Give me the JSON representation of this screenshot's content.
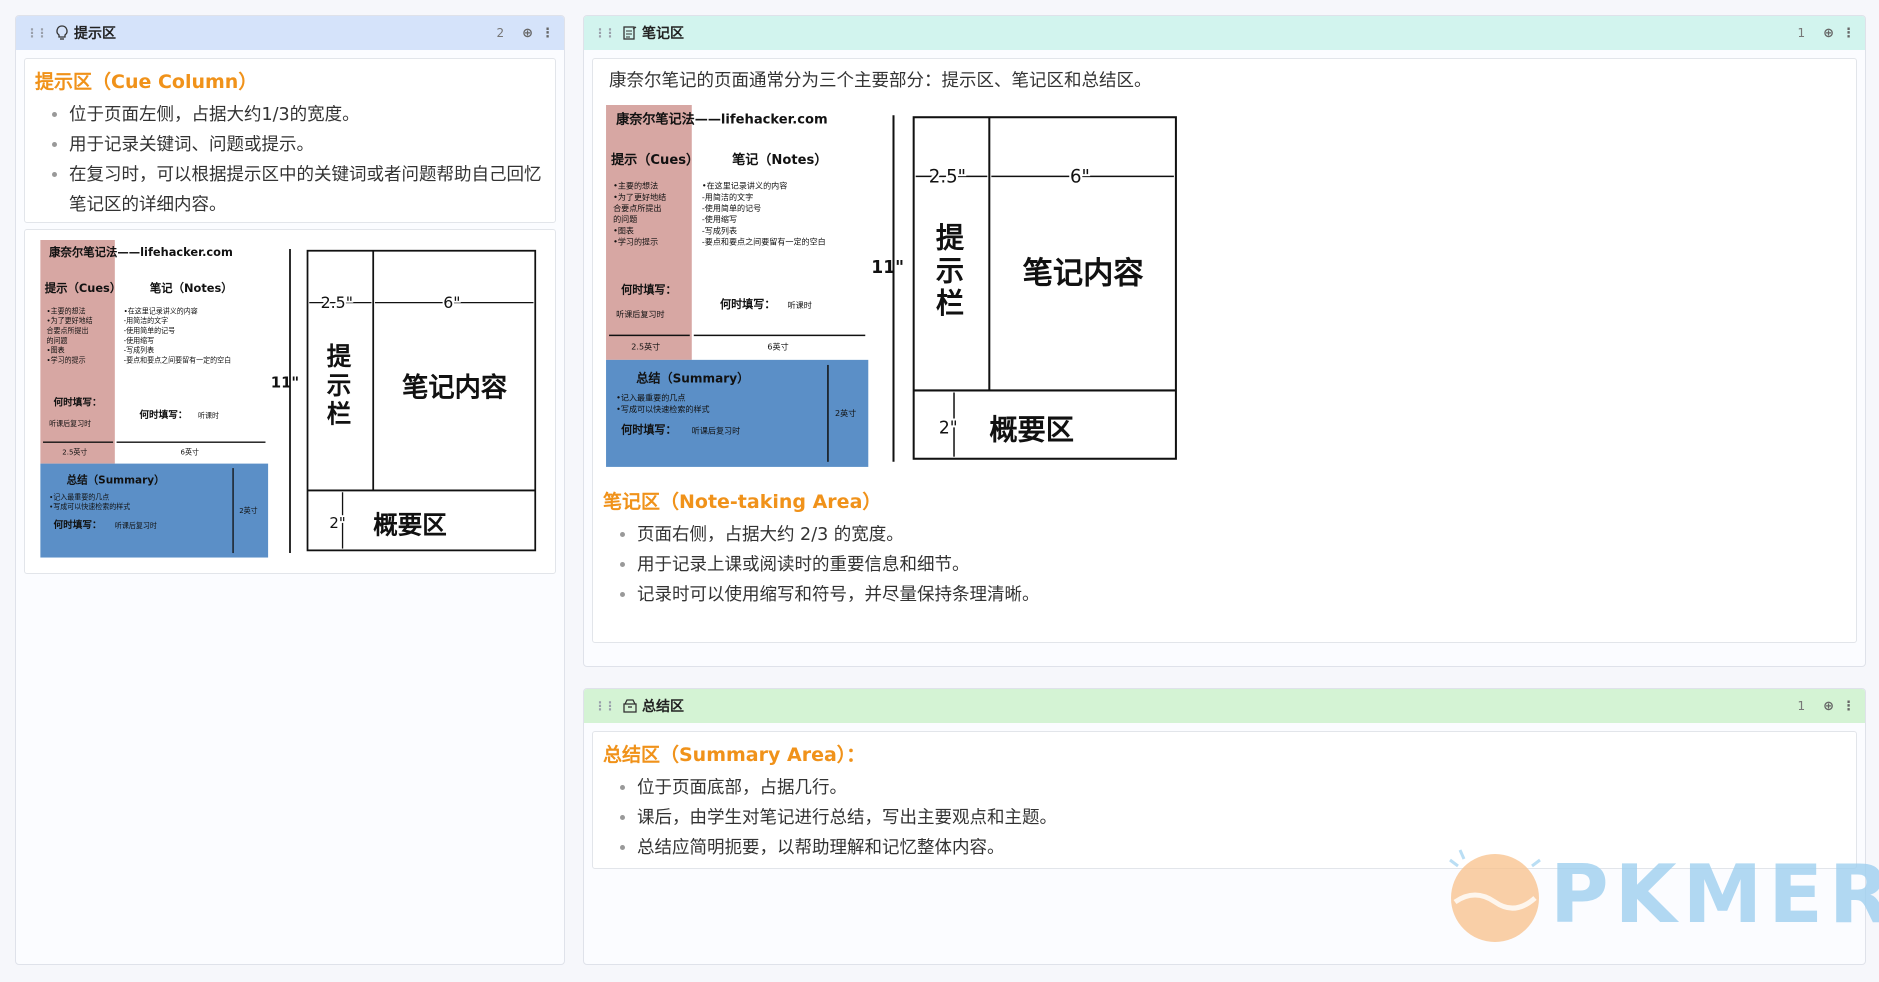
{
  "columns": [
    {
      "title": "提示区",
      "count": "2",
      "icon": "lightbulb-icon",
      "color": "#d5e3fa"
    },
    {
      "title": "笔记区",
      "count": "1",
      "icon": "note-icon",
      "color": "#d2f4ee"
    },
    {
      "title": "总结区",
      "count": "1",
      "icon": "archive-icon",
      "color": "#d4f3d4"
    }
  ],
  "cue": {
    "title": "提示区（Cue Column）",
    "bullets": [
      "位于页面左侧，占据大约1/3的宽度。",
      "用于记录关键词、问题或提示。",
      "在复习时，可以根据提示区中的关键词或者问题帮助自己回忆笔记区的详细内容。"
    ]
  },
  "notes": {
    "intro": "康奈尔笔记的页面通常分为三个主要部分：提示区、笔记区和总结区。",
    "title": "笔记区（Note-taking Area）",
    "bullets": [
      "页面右侧，占据大约 2/3 的宽度。",
      "用于记录上课或阅读时的重要信息和细节。",
      "记录时可以使用缩写和符号，并尽量保持条理清晰。"
    ]
  },
  "summary": {
    "title": "总结区（Summary Area）：",
    "bullets": [
      "位于页面底部，占据几行。",
      "课后，由学生对笔记进行总结，写出主要观点和主题。",
      "总结应简明扼要，以帮助理解和记忆整体内容。"
    ]
  },
  "figure": {
    "header": "康奈尔笔记法——lifehacker.com",
    "cues_label": "提示（Cues）",
    "notes_label": "笔记（Notes）",
    "cues_items": [
      "•主要的想法",
      "•为了更好地结",
      "合要点所提出",
      "的问题",
      "•图表",
      "•学习的提示"
    ],
    "notes_items": [
      "•在这里记录讲义的内容",
      "-用简洁的文字",
      "-使用简单的记号",
      "-使用缩写",
      "-写成列表",
      "-要点和要点之间要留有一定的空白"
    ],
    "when_label": "何时填写：",
    "when_cues": "听课后复习时",
    "when_notes": "听课时",
    "width_cues": "2.5英寸",
    "width_notes": "6英寸",
    "summary_label": "总结（Summary）",
    "summary_items": [
      "•记入最重要的几点",
      "•写成可以快速检索的样式"
    ],
    "when_summary": "听课后复习时",
    "summary_height": "2英寸",
    "dim_25": "2.5\"",
    "dim_6": "6\"",
    "dim_11": "11\"",
    "dim_2": "2\"",
    "cue_col_text": "提示栏",
    "notes_box_text": "笔记内容",
    "summary_box_text": "概要区"
  },
  "watermark": {
    "text": "PKMER"
  }
}
